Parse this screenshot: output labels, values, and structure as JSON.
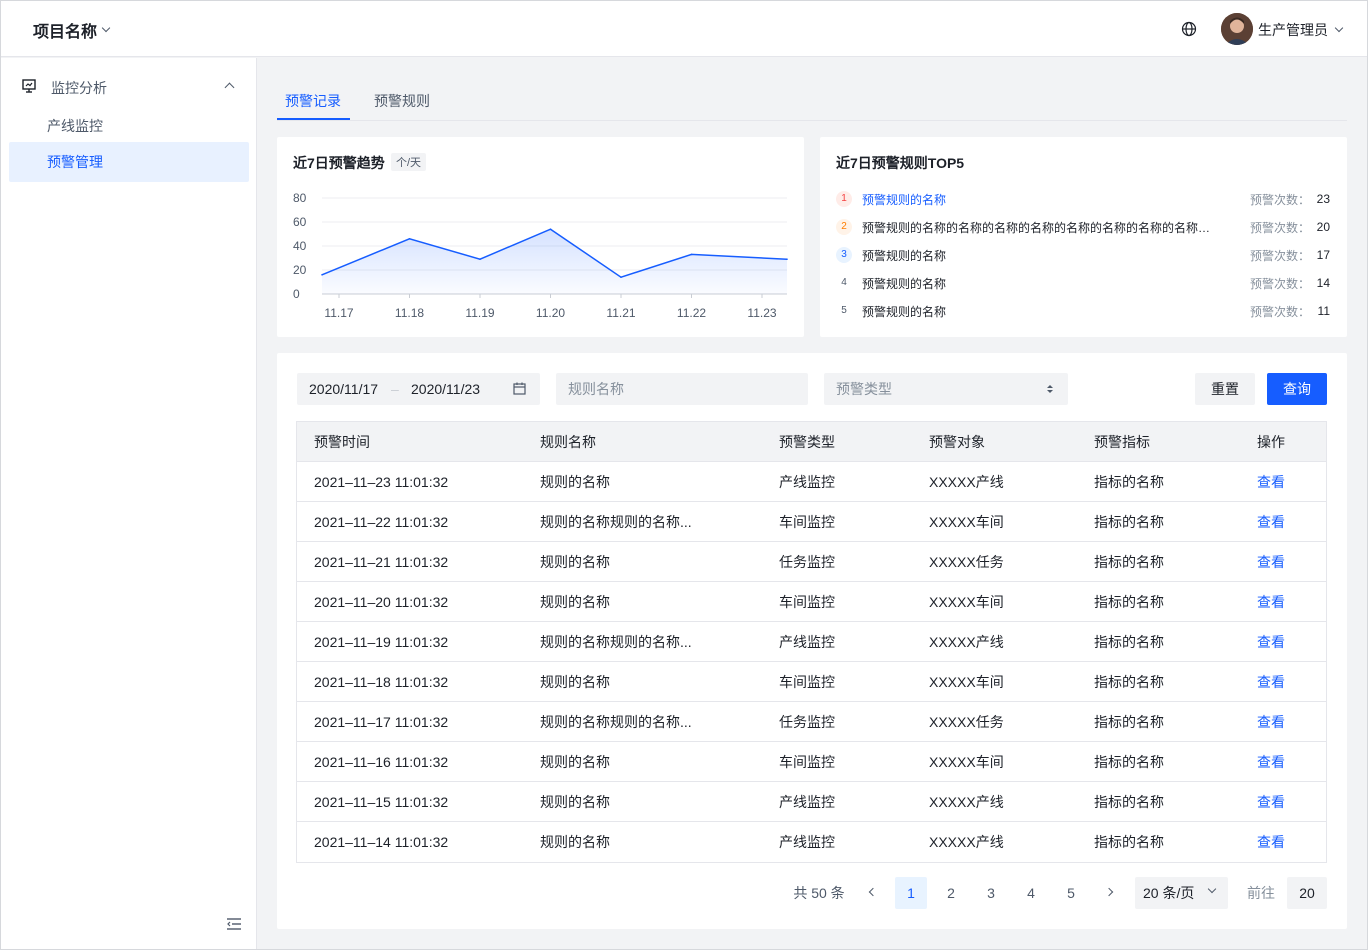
{
  "header": {
    "project_name": "项目名称",
    "user_name": "生产管理员"
  },
  "sidebar": {
    "group_label": "监控分析",
    "items": [
      {
        "label": "产线监控"
      },
      {
        "label": "预警管理"
      }
    ]
  },
  "tabs": [
    {
      "label": "预警记录"
    },
    {
      "label": "预警规则"
    }
  ],
  "trend": {
    "title": "近7日预警趋势",
    "unit": "个/天"
  },
  "chart_data": {
    "type": "area",
    "x": [
      "11.17",
      "11.18",
      "11.19",
      "11.20",
      "11.21",
      "11.22",
      "11.23"
    ],
    "y_ticks": [
      "80",
      "60",
      "40",
      "20",
      "0"
    ],
    "series": [
      {
        "values": [
          16,
          46,
          29,
          54,
          14,
          33,
          29
        ]
      }
    ],
    "ylim": [
      0,
      80
    ],
    "grid": true,
    "color": "#165dff"
  },
  "top5": {
    "title": "近7日预警规则TOP5",
    "count_label": "预警次数：",
    "items": [
      {
        "rank": "1",
        "name": "预警规则的名称",
        "count": "23"
      },
      {
        "rank": "2",
        "name": "预警规则的名称的名称的名称的名称的名称的名称的名称的名称的名称…",
        "count": "20"
      },
      {
        "rank": "3",
        "name": "预警规则的名称",
        "count": "17"
      },
      {
        "rank": "4",
        "name": "预警规则的名称",
        "count": "14"
      },
      {
        "rank": "5",
        "name": "预警规则的名称",
        "count": "11"
      }
    ]
  },
  "filters": {
    "date_start": "2020/11/17",
    "date_sep": "–",
    "date_end": "2020/11/23",
    "rule_placeholder": "规则名称",
    "type_placeholder": "预警类型",
    "reset": "重置",
    "query": "查询"
  },
  "table": {
    "columns": [
      "预警时间",
      "规则名称",
      "预警类型",
      "预警对象",
      "预警指标",
      "操作"
    ],
    "rows": [
      [
        "2021–11–23 11:01:32",
        "规则的名称",
        "产线监控",
        "XXXXX产线",
        "指标的名称",
        "查看"
      ],
      [
        "2021–11–22 11:01:32",
        "规则的名称规则的名称...",
        "车间监控",
        "XXXXX车间",
        "指标的名称",
        "查看"
      ],
      [
        "2021–11–21 11:01:32",
        "规则的名称",
        "任务监控",
        "XXXXX任务",
        "指标的名称",
        "查看"
      ],
      [
        "2021–11–20 11:01:32",
        "规则的名称",
        "车间监控",
        "XXXXX车间",
        "指标的名称",
        "查看"
      ],
      [
        "2021–11–19 11:01:32",
        "规则的名称规则的名称...",
        "产线监控",
        "XXXXX产线",
        "指标的名称",
        "查看"
      ],
      [
        "2021–11–18 11:01:32",
        "规则的名称",
        "车间监控",
        "XXXXX车间",
        "指标的名称",
        "查看"
      ],
      [
        "2021–11–17 11:01:32",
        "规则的名称规则的名称...",
        "任务监控",
        "XXXXX任务",
        "指标的名称",
        "查看"
      ],
      [
        "2021–11–16 11:01:32",
        "规则的名称",
        "车间监控",
        "XXXXX车间",
        "指标的名称",
        "查看"
      ],
      [
        "2021–11–15 11:01:32",
        "规则的名称",
        "产线监控",
        "XXXXX产线",
        "指标的名称",
        "查看"
      ],
      [
        "2021–11–14 11:01:32",
        "规则的名称",
        "产线监控",
        "XXXXX产线",
        "指标的名称",
        "查看"
      ]
    ]
  },
  "pagination": {
    "total": "共 50 条",
    "pages": [
      "1",
      "2",
      "3",
      "4",
      "5"
    ],
    "current": "1",
    "page_size": "20 条/页",
    "goto_label": "前往",
    "goto_value": "20"
  },
  "icons": {
    "project_dropdown": "chevron-down-icon",
    "language": "globe-icon",
    "user_dropdown": "chevron-down-icon",
    "menu_group": "monitor-icon",
    "menu_collapse": "chevron-up-icon",
    "sidebar_toggle": "menu-fold-icon",
    "date": "calendar-icon",
    "select": "sort-icon",
    "prev": "chevron-left-icon",
    "next": "chevron-right-icon"
  }
}
